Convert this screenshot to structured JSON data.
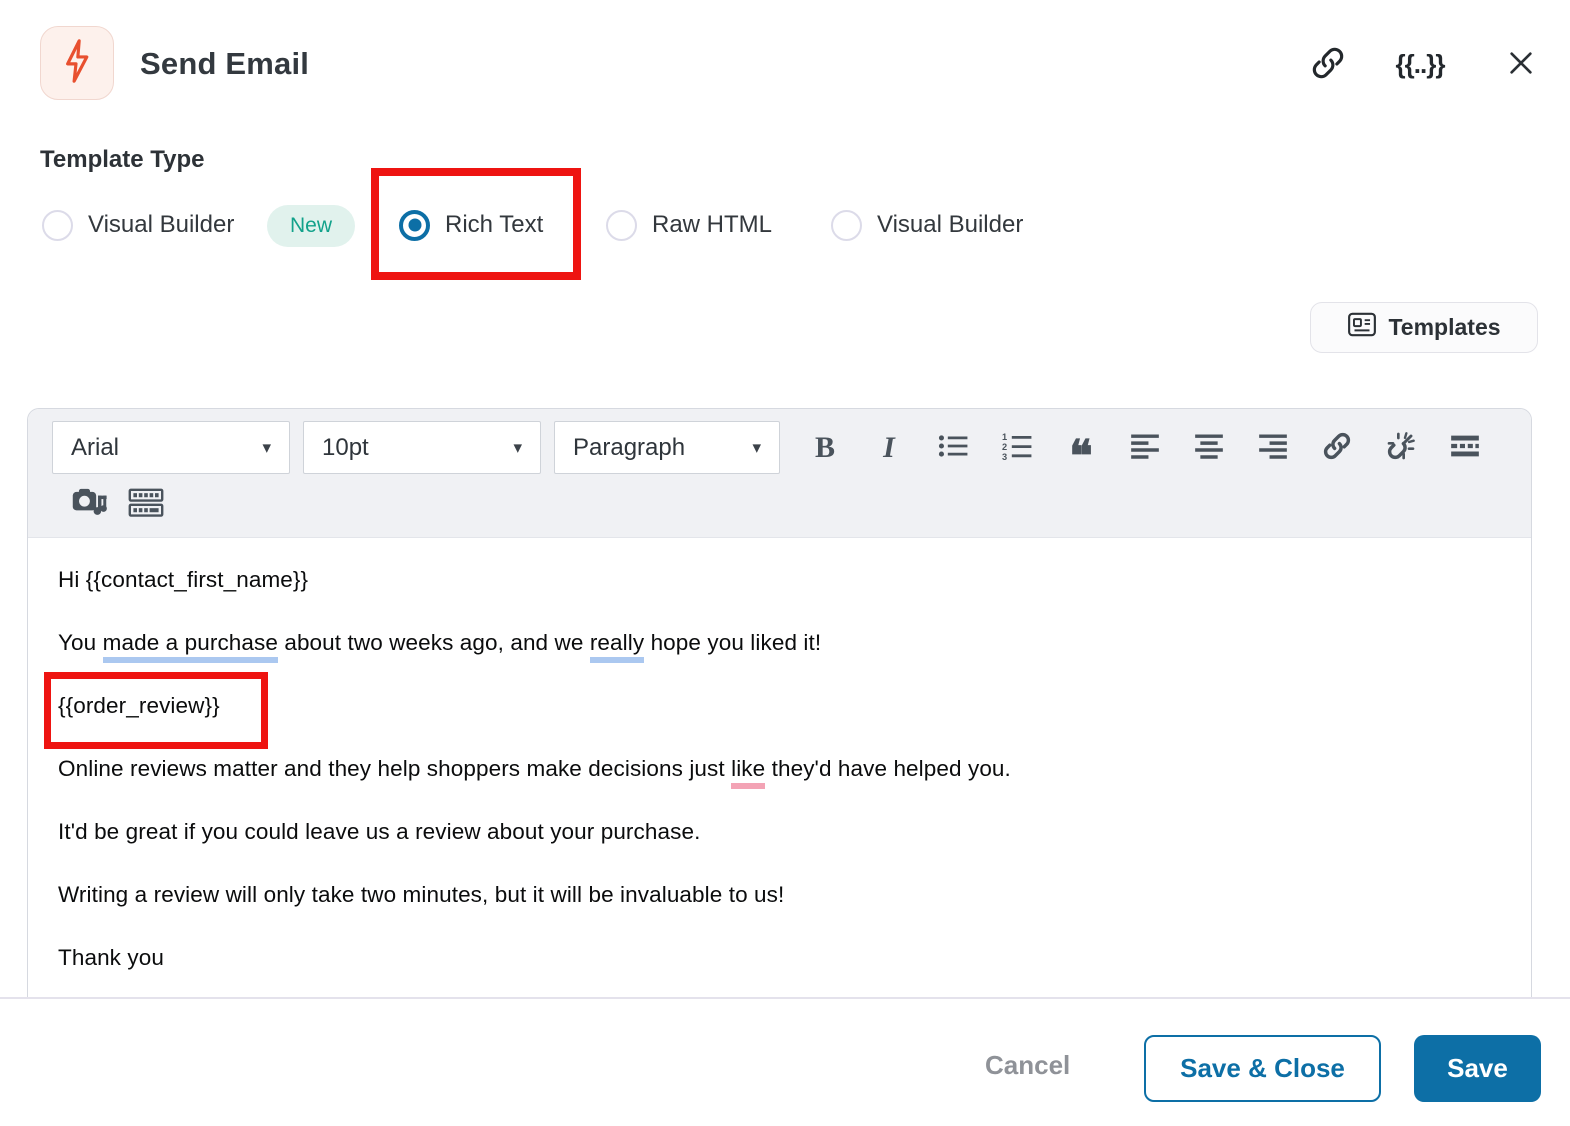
{
  "header": {
    "title": "Send Email",
    "merge_fields_glyph": "{{..}}"
  },
  "template_type": {
    "label": "Template Type",
    "options": [
      {
        "label": "Visual Builder",
        "selected": false,
        "badge": "New"
      },
      {
        "label": "Rich Text",
        "selected": true
      },
      {
        "label": "Raw HTML",
        "selected": false
      },
      {
        "label": "Visual Builder",
        "selected": false
      }
    ]
  },
  "templates_button": {
    "label": "Templates"
  },
  "editor": {
    "toolbar": {
      "font_family": "Arial",
      "font_size": "10pt",
      "paragraph_style": "Paragraph",
      "glyphs": {
        "bold": "B",
        "italic": "I",
        "blockquote": "❝",
        "dropdown_arrow": "▾"
      }
    },
    "content": {
      "p1": "Hi {{contact_first_name}}",
      "p2": {
        "s1": "You ",
        "s2": "made a purchase",
        "s3": " about two weeks ago, and we ",
        "s4": "really",
        "s5": " hope you liked it!"
      },
      "p3": "{{order_review}}",
      "p4": {
        "s1": "Online reviews matter and they help shoppers make decisions just ",
        "s2": "like",
        "s3": " they'd have helped you."
      },
      "p5": "It'd be great if you could leave us a review about your purchase.",
      "p6": "Writing a review will only take two minutes, but it will be invaluable to us!",
      "p7": "Thank you"
    }
  },
  "footer": {
    "cancel_label": "Cancel",
    "save_close_label": "Save & Close",
    "save_label": "Save"
  },
  "colors": {
    "accent_blue": "#0d6fa6",
    "annotation_red": "#ee1411",
    "badge_teal_text": "#12a28b",
    "badge_teal_bg": "#e1f2ed",
    "flash_orange": "#e8502f",
    "spellcheck_blue": "#abc8f0",
    "spellcheck_pink": "#f3a3b5"
  }
}
